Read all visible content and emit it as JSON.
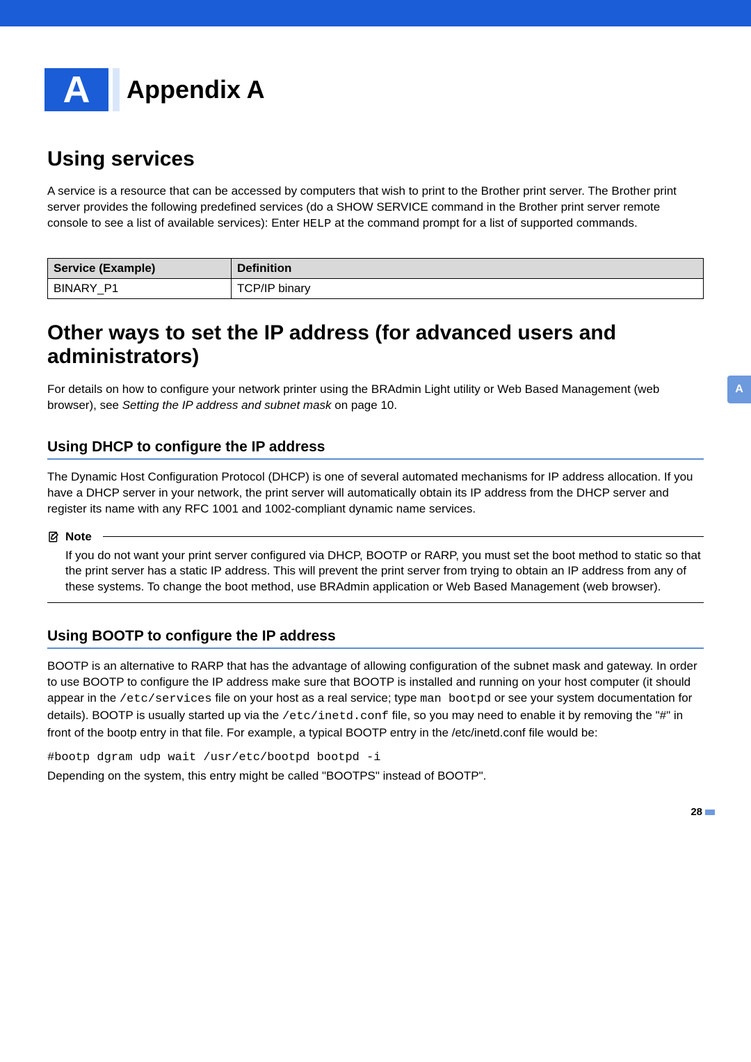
{
  "chapter": {
    "letter": "A",
    "title": "Appendix A"
  },
  "section1": {
    "heading": "Using services",
    "paragraph_before_help": "A service is a resource that can be accessed by computers that wish to print to the Brother print server. The Brother print server provides the following predefined services (do a SHOW SERVICE command in the Brother print server remote console to see a list of available services): Enter ",
    "help_code": "HELP",
    "paragraph_after_help": " at the command prompt for a list of supported commands."
  },
  "table": {
    "header_service": "Service (Example)",
    "header_definition": "Definition",
    "row1_service": "BINARY_P1",
    "row1_definition": "TCP/IP binary"
  },
  "section2": {
    "heading": "Other ways to set the IP address (for advanced users and administrators)",
    "para_before_italic": "For details on how to configure your network printer using the BRAdmin Light utility or Web Based Management (web browser), see ",
    "italic_ref": "Setting the IP address and subnet mask",
    "para_after_italic": " on page 10."
  },
  "dhcp": {
    "heading": "Using DHCP to configure the IP address",
    "para": "The Dynamic Host Configuration Protocol (DHCP) is one of several automated mechanisms for IP address allocation. If you have a DHCP server in your network, the print server will automatically obtain its IP address from the DHCP server and register its name with any RFC 1001 and 1002-compliant dynamic name services."
  },
  "note": {
    "label": "Note",
    "body": "If you do not want your print server configured via DHCP, BOOTP or RARP, you must set the boot method to static so that the print server has a static IP address. This will prevent the print server from trying to obtain an IP address from any of these systems. To change the boot method, use BRAdmin application or Web Based Management (web browser)."
  },
  "bootp": {
    "heading": "Using BOOTP to configure the IP address",
    "p1_a": "BOOTP is an alternative to RARP that has the advantage of allowing configuration of the subnet mask and gateway. In order to use BOOTP to configure the IP address make sure that BOOTP is installed and running on your host computer (it should appear in the ",
    "p1_code1": "/etc/services",
    "p1_b": " file on your host as a real service; type ",
    "p1_code2": "man bootpd",
    "p1_c": " or see your system documentation for details). BOOTP is usually started up via the ",
    "p1_code3": "/etc/inetd.conf",
    "p1_d": " file, so you may need to enable it by removing the \"#\" in front of the bootp entry in that file. For example, a typical BOOTP entry in the /etc/inetd.conf file would be:",
    "codeline": "#bootp dgram udp wait /usr/etc/bootpd bootpd -i",
    "p2": "Depending on the system, this entry might be called \"BOOTPS\" instead of BOOTP\"."
  },
  "sidetab": "A",
  "page_number": "28"
}
